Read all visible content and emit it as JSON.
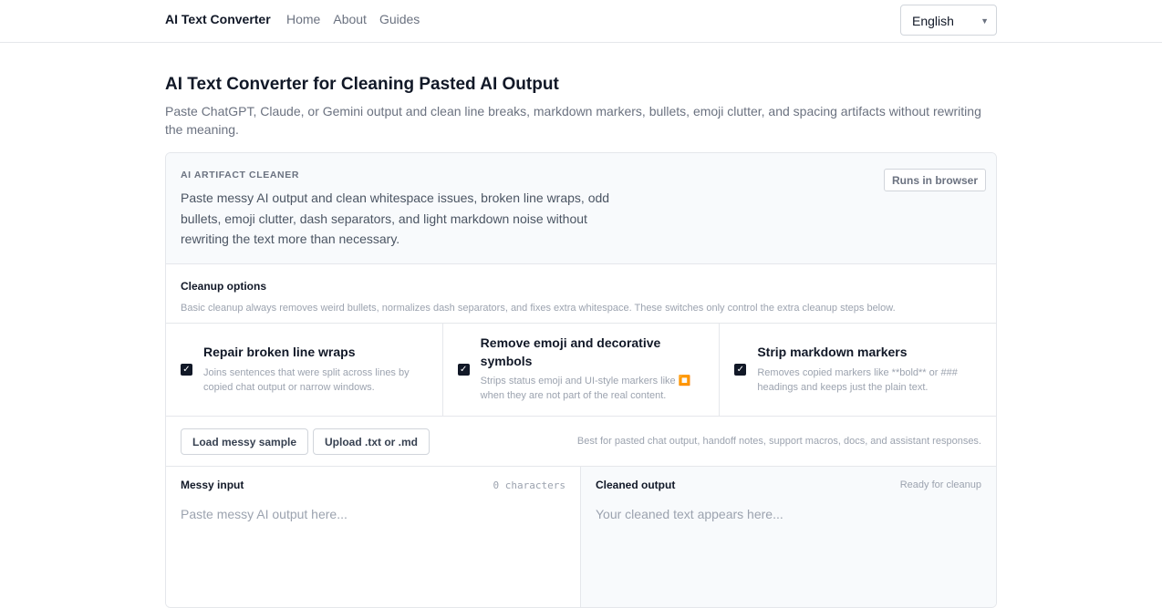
{
  "header": {
    "brand": "AI Text Converter",
    "nav": [
      "Home",
      "About",
      "Guides"
    ],
    "language": "English"
  },
  "page": {
    "title": "AI Text Converter for Cleaning Pasted AI Output",
    "subtitle": "Paste ChatGPT, Claude, or Gemini output and clean line breaks, markdown markers, bullets, emoji clutter, and spacing artifacts without rewriting the meaning."
  },
  "cleaner": {
    "eyebrow": "AI ARTIFACT CLEANER",
    "description": "Paste messy AI output and clean whitespace issues, broken line wraps, odd bullets, emoji clutter, dash separators, and light markdown noise without rewriting the text more than necessary.",
    "badge": "Runs in browser",
    "options_title": "Cleanup options",
    "options_subtitle": "Basic cleanup always removes weird bullets, normalizes dash separators, and fixes extra whitespace. These switches only control the extra cleanup steps below.",
    "options": [
      {
        "name": "Repair broken line wraps",
        "desc": "Joins sentences that were split across lines by copied chat output or narrow windows.",
        "checked": true
      },
      {
        "name": "Remove emoji and decorative symbols",
        "desc": "Strips status emoji and UI-style markers like ⏹️ when they are not part of the real content.",
        "checked": true
      },
      {
        "name": "Strip markdown markers",
        "desc": "Removes copied markers like **bold** or ### headings and keeps just the plain text.",
        "checked": true
      }
    ],
    "load_sample": "Load messy sample",
    "upload": "Upload .txt or .md",
    "hint": "Best for pasted chat output, handoff notes, support macros, docs, and assistant responses.",
    "input_label": "Messy input",
    "input_count": "0 characters",
    "input_placeholder": "Paste messy AI output here...",
    "output_label": "Cleaned output",
    "output_status": "Ready for cleanup",
    "output_placeholder": "Your cleaned text appears here..."
  },
  "colors": {
    "text": "#111827",
    "muted": "#6b7280",
    "border": "#e5e7eb",
    "panel_bg": "#f8fafc",
    "checkbox": "#111827"
  }
}
